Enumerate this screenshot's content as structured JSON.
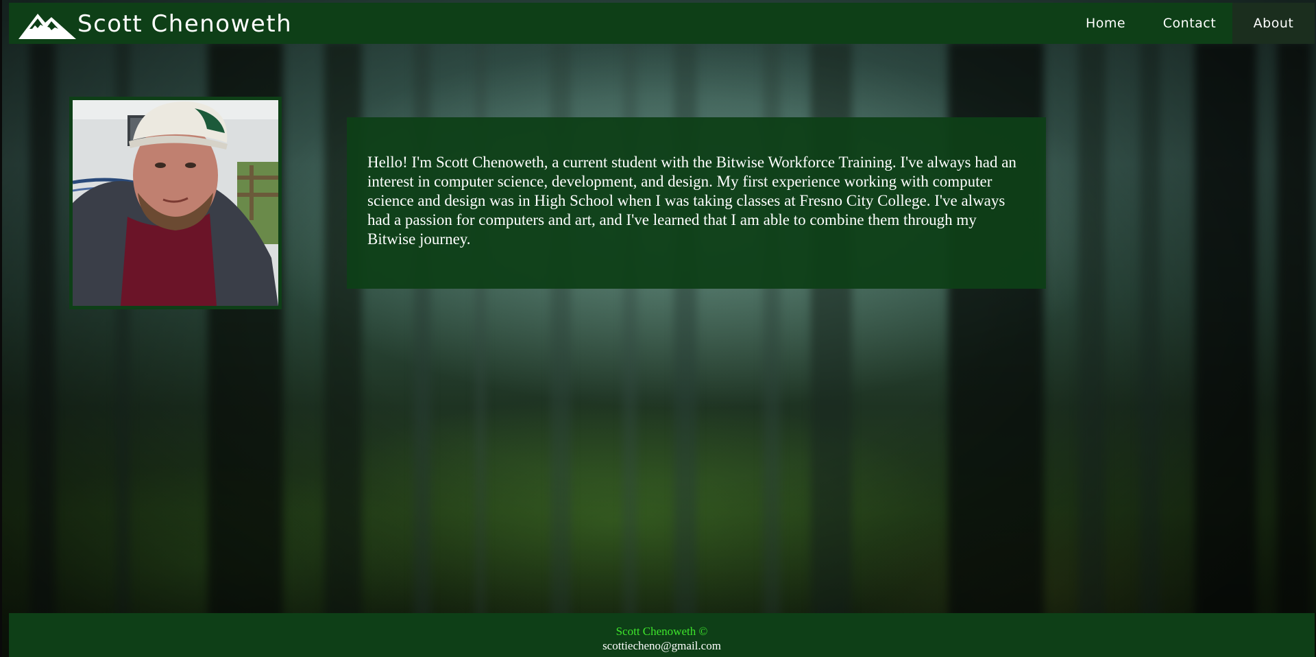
{
  "header": {
    "brand_name": "Scott Chenoweth",
    "nav": [
      {
        "label": "Home",
        "active": false
      },
      {
        "label": "Contact",
        "active": false
      },
      {
        "label": "About",
        "active": true
      }
    ]
  },
  "main": {
    "profile_photo": {
      "alt": "Portrait photo of Scott Chenoweth"
    },
    "bio": "Hello! I'm Scott Chenoweth, a current student with the Bitwise Workforce Training. I've always had an interest in computer science, development, and design. My first experience working with computer science and design was in High School when I was taking classes at Fresno City College. I've always had a passion for computers and art, and I've learned that I am able to combine them through my Bitwise journey."
  },
  "footer": {
    "copyright": "Scott Chenoweth ©",
    "email": "scottiecheno@gmail.com"
  },
  "colors": {
    "nav_background": "#0e3f17",
    "nav_active_background": "#1b2e1e",
    "footer_name_color": "#3ee62c",
    "text_color": "#ffffff"
  },
  "icons": {
    "logo": "mountain-logo-icon"
  }
}
